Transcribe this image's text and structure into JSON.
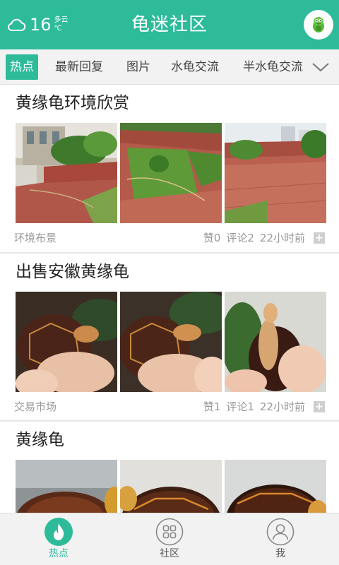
{
  "status": {
    "temperature": "16",
    "condition": "多云",
    "unit": "℃"
  },
  "header": {
    "title": "龟迷社区"
  },
  "tabs": [
    {
      "label": "热点",
      "active": true
    },
    {
      "label": "最新回复",
      "active": false
    },
    {
      "label": "图片",
      "active": false
    },
    {
      "label": "水龟交流",
      "active": false
    },
    {
      "label": "半水龟交流",
      "active": false
    }
  ],
  "posts": [
    {
      "title": "黄缘龟环境欣赏",
      "category": "环境布景",
      "likes": "赞0",
      "comments": "评论2",
      "time": "22小时前",
      "more": "+"
    },
    {
      "title": "出售安徽黄缘龟",
      "category": "交易市场",
      "likes": "赞1",
      "comments": "评论1",
      "time": "22小时前",
      "more": "+"
    },
    {
      "title": "黄缘龟"
    }
  ],
  "bottom_nav": [
    {
      "label": "热点",
      "icon": "flame-icon",
      "active": true
    },
    {
      "label": "社区",
      "icon": "grid-icon",
      "active": false
    },
    {
      "label": "我",
      "icon": "user-icon",
      "active": false
    }
  ],
  "colors": {
    "accent": "#2dbb9a",
    "meta_text": "#999999",
    "tab_bar": "#f2f2f2"
  }
}
